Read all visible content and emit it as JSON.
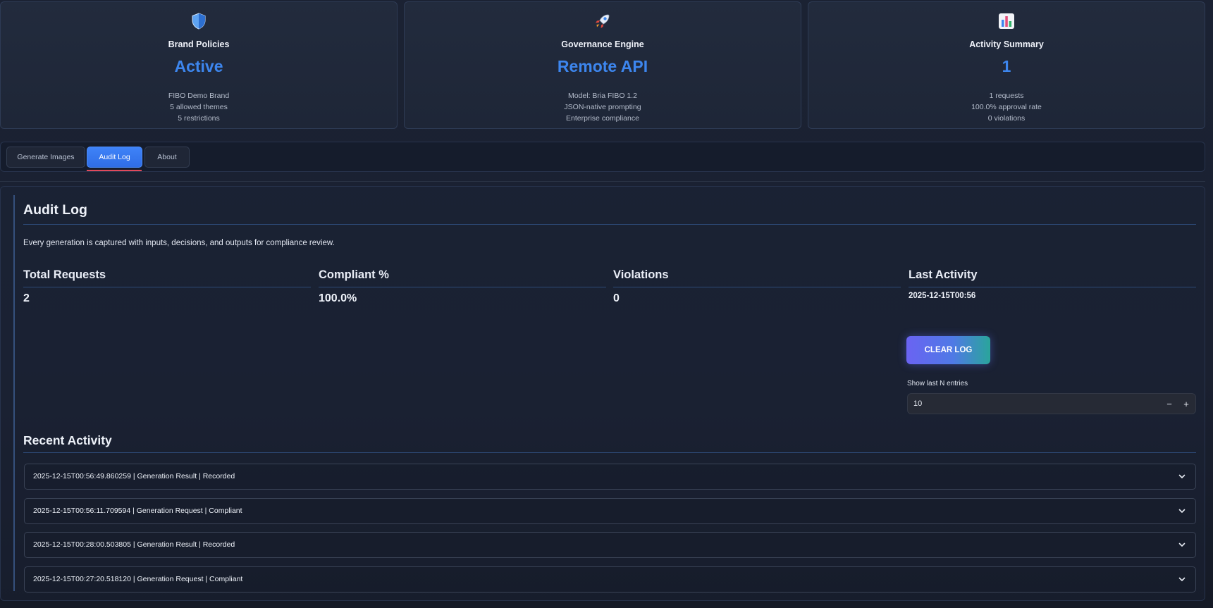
{
  "cards": [
    {
      "icon": "shield-icon",
      "title": "Brand Policies",
      "value": "Active",
      "lines": [
        "FIBO Demo Brand",
        "5 allowed themes",
        "5 restrictions"
      ]
    },
    {
      "icon": "rocket-icon",
      "title": "Governance Engine",
      "value": "Remote API",
      "lines": [
        "Model: Bria FIBO 1.2",
        "JSON-native prompting",
        "Enterprise compliance"
      ]
    },
    {
      "icon": "bar-chart-icon",
      "title": "Activity Summary",
      "value": "1",
      "lines": [
        "1 requests",
        "100.0% approval rate",
        "0 violations"
      ]
    }
  ],
  "tabs": [
    {
      "label": "Generate Images",
      "active": false
    },
    {
      "label": "Audit Log",
      "active": true
    },
    {
      "label": "About",
      "active": false
    }
  ],
  "audit": {
    "title": "Audit Log",
    "description": "Every generation is captured with inputs, decisions, and outputs for compliance review.",
    "metrics": [
      {
        "label": "Total Requests",
        "value": "2"
      },
      {
        "label": "Compliant %",
        "value": "100.0%"
      },
      {
        "label": "Violations",
        "value": "0"
      },
      {
        "label": "Last Activity",
        "value": "2025-12-15T00:56"
      }
    ],
    "clear_label": "CLEAR LOG",
    "entries_label": "Show last N entries",
    "entries_value": "10",
    "decrement": "−",
    "increment": "+"
  },
  "recent": {
    "title": "Recent Activity",
    "entries": [
      "2025-12-15T00:56:49.860259 | Generation Result | Recorded",
      "2025-12-15T00:56:11.709594 | Generation Request | Compliant",
      "2025-12-15T00:28:00.503805 | Generation Result | Recorded",
      "2025-12-15T00:27:20.518120 | Generation Request | Compliant"
    ]
  },
  "colors": {
    "accent": "#3d86ee",
    "tab_active": "#3f83f8",
    "tab_indicator": "#e04a5c"
  }
}
